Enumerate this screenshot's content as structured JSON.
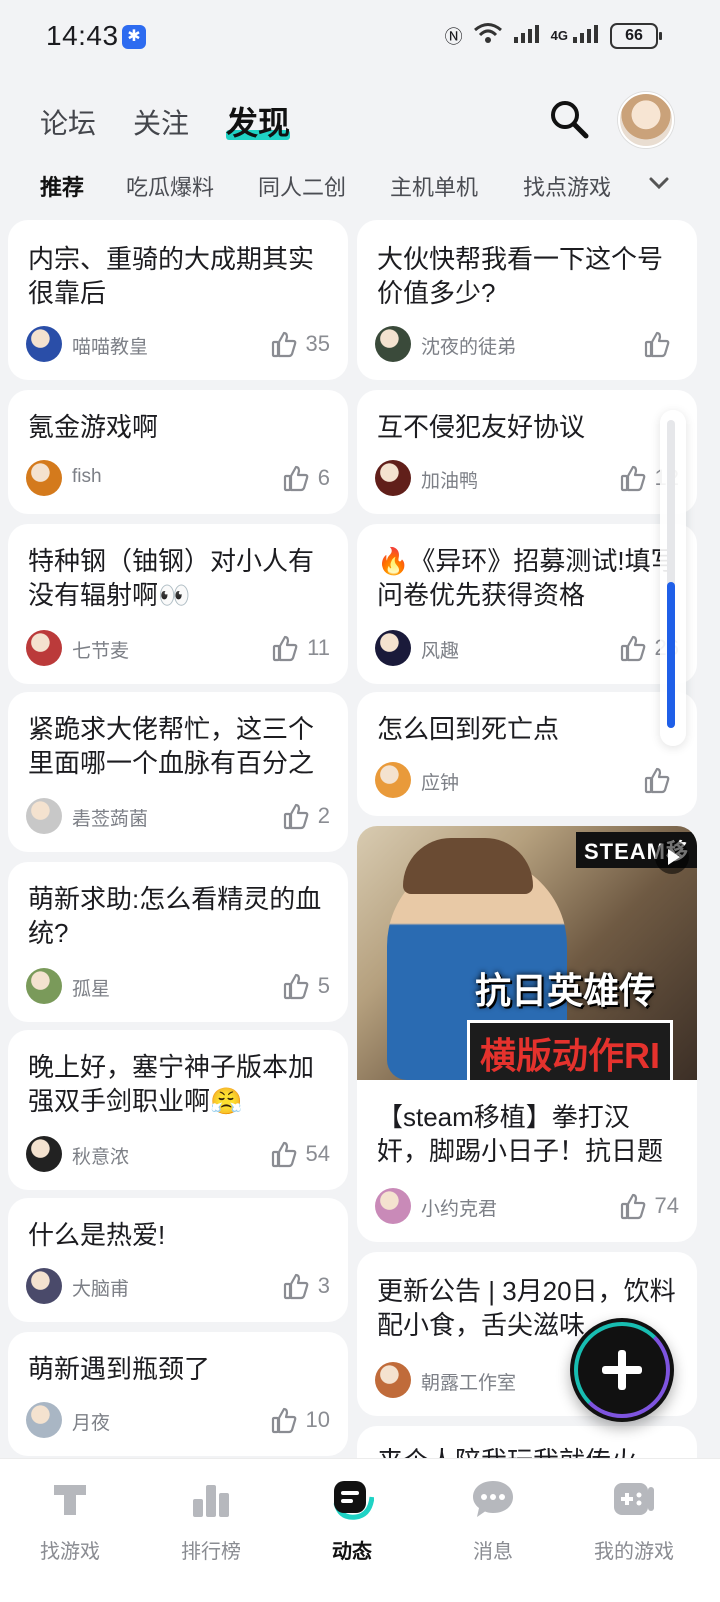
{
  "status_bar": {
    "time": "14:43",
    "network": "4G",
    "battery": "66"
  },
  "header": {
    "tabs": [
      {
        "label": "论坛",
        "active": false
      },
      {
        "label": "关注",
        "active": false
      },
      {
        "label": "发现",
        "active": true
      }
    ]
  },
  "subtabs": [
    {
      "label": "推荐",
      "active": true
    },
    {
      "label": "吃瓜爆料",
      "active": false
    },
    {
      "label": "同人二创",
      "active": false
    },
    {
      "label": "主机单机",
      "active": false
    },
    {
      "label": "找点游戏",
      "active": false
    }
  ],
  "feed": {
    "left": [
      {
        "title": "内宗、重骑的大成期其实很靠后",
        "author": "喵喵教皇",
        "likes": "35"
      },
      {
        "title": "氪金游戏啊",
        "author": "fish",
        "likes": "6"
      },
      {
        "title": "特种钢（铀钢）对小人有没有辐射啊👀",
        "author": "七节麦",
        "likes": "11"
      },
      {
        "title": "紧跪求大佬帮忙，这三个里面哪一个血脉有百分之",
        "author": "砉莶蒟菌",
        "likes": "2"
      },
      {
        "title": "萌新求助:怎么看精灵的血统?",
        "author": "孤星",
        "likes": "5"
      },
      {
        "title": "晚上好，塞宁神子版本加强双手剑职业啊😤",
        "author": "秋意浓",
        "likes": "54"
      },
      {
        "title": "什么是热爱!",
        "author": "大脑甫",
        "likes": "3"
      },
      {
        "title": "萌新遇到瓶颈了",
        "author": "月夜",
        "likes": "10"
      }
    ],
    "right": [
      {
        "title": "大伙快帮我看一下这个号价值多少?",
        "author": "沈夜的徒弟",
        "likes": ""
      },
      {
        "title": "互不侵犯友好协议",
        "author": "加油鸭",
        "likes": "12"
      },
      {
        "title": "🔥《异环》招募测试!填写问卷优先获得资格",
        "author": "风趣",
        "likes": "26"
      },
      {
        "title": "怎么回到死亡点",
        "author": "应钟",
        "likes": ""
      },
      {
        "title": "【steam移植】拳打汉奸，脚踢小日子！抗日题",
        "author": "小约克君",
        "likes": "74",
        "media": {
          "tag": "STEAM移",
          "line1": "抗日英雄传",
          "line2": "横版动作RI"
        }
      },
      {
        "title": "更新公告 | 3月20日，饮料配小食，舌尖滋味",
        "author": "朝露工作室",
        "likes": ""
      },
      {
        "title": "来个人陪我玩我就传火",
        "author": "",
        "likes": ""
      }
    ]
  },
  "bottom_nav": [
    {
      "label": "找游戏",
      "icon": "find-game-icon",
      "active": false
    },
    {
      "label": "排行榜",
      "icon": "ranking-icon",
      "active": false
    },
    {
      "label": "动态",
      "icon": "feed-icon",
      "active": true
    },
    {
      "label": "消息",
      "icon": "message-icon",
      "active": false
    },
    {
      "label": "我的游戏",
      "icon": "my-games-icon",
      "active": false
    }
  ],
  "colors": {
    "accent": "#1fd3c5",
    "scroll_thumb": "#1f5fe8"
  }
}
